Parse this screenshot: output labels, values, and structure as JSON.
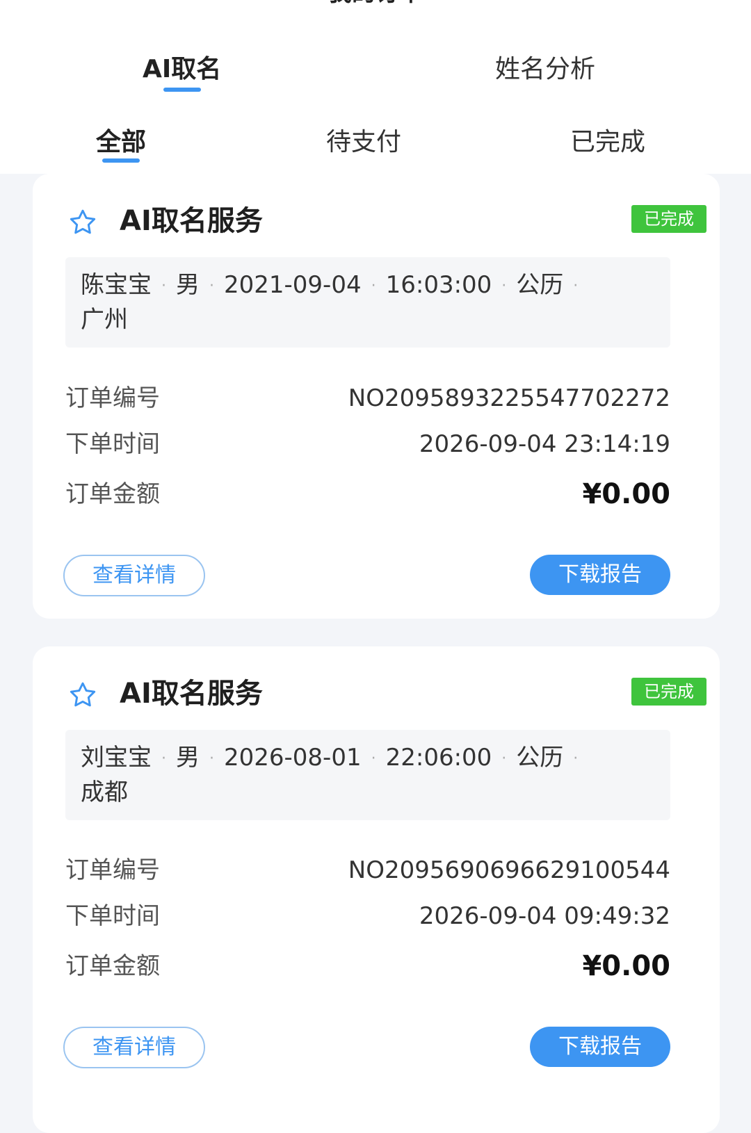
{
  "header": {
    "title": "我的订单"
  },
  "main_tabs": [
    {
      "label": "AI取名",
      "active": true
    },
    {
      "label": "姓名分析",
      "active": false
    }
  ],
  "status_tabs": [
    {
      "label": "全部",
      "active": true
    },
    {
      "label": "待支付",
      "active": false
    },
    {
      "label": "已完成",
      "active": false
    }
  ],
  "labels": {
    "order_no": "订单编号",
    "order_time": "下单时间",
    "amount": "订单金额",
    "view_details": "查看详情",
    "download_report": "下载报告"
  },
  "orders": [
    {
      "service": "AI取名服务",
      "status": "已完成",
      "name": "陈宝宝",
      "gender": "男",
      "birth_date": "2021-09-04",
      "birth_time": "16:03:00",
      "calendar": "公历",
      "city": "广州",
      "order_no": "NO2095893225547702272",
      "order_time": "2026-09-04 23:14:19",
      "amount": "¥0.00"
    },
    {
      "service": "AI取名服务",
      "status": "已完成",
      "name": "刘宝宝",
      "gender": "男",
      "birth_date": "2026-08-01",
      "birth_time": "22:06:00",
      "calendar": "公历",
      "city": "成都",
      "order_no": "NO2095690696629100544",
      "order_time": "2026-09-04 09:49:32",
      "amount": "¥0.00"
    }
  ],
  "colors": {
    "accent": "#3d95f2",
    "badge_green": "#3fc43d",
    "background": "#f3f5f9"
  },
  "icons": {
    "service_icon": "star-outline-icon"
  }
}
